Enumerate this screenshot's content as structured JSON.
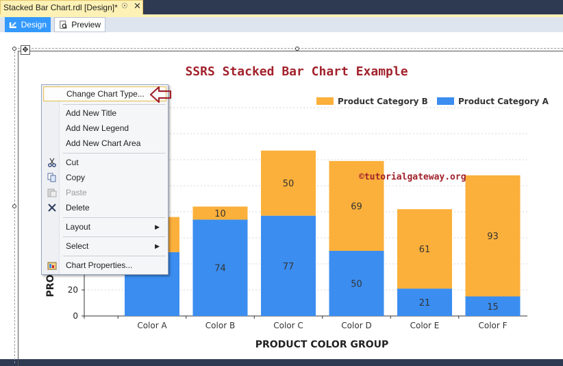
{
  "document_tab": {
    "title": "Stacked Bar Chart.rdl [Design]*",
    "pin_icon": "pin-icon",
    "close_icon": "close-icon"
  },
  "view_tabs": [
    {
      "label": "Design",
      "active": true,
      "icon": "design-icon"
    },
    {
      "label": "Preview",
      "active": false,
      "icon": "preview-icon"
    }
  ],
  "context_menu": {
    "items": [
      {
        "label": "Change Chart Type...",
        "state": "active"
      },
      {
        "label": "Add New Title"
      },
      {
        "label": "Add New Legend"
      },
      {
        "label": "Add New Chart Area"
      },
      {
        "label": "Cut",
        "icon": "scissors-icon"
      },
      {
        "label": "Copy",
        "icon": "copy-icon"
      },
      {
        "label": "Paste",
        "icon": "paste-icon",
        "state": "disabled"
      },
      {
        "label": "Delete",
        "icon": "delete-icon"
      },
      {
        "label": "Layout",
        "submenu": true
      },
      {
        "label": "Select",
        "submenu": true
      },
      {
        "label": "Chart Properties...",
        "icon": "properties-icon"
      }
    ]
  },
  "watermark": "©tutorialgateway.org",
  "colors": {
    "series_a": "#3b8df0",
    "series_b": "#fbb03b",
    "title": "#a1222c",
    "accent": "#3399ff"
  },
  "chart_data": {
    "type": "bar",
    "stacked": true,
    "title": "SSRS Stacked Bar Chart Example",
    "xlabel": "PRODUCT COLOR GROUP",
    "ylabel": "PRO",
    "categories": [
      "Color A",
      "Color B",
      "Color C",
      "Color D",
      "Color E",
      "Color F"
    ],
    "series": [
      {
        "name": "Product Category A",
        "values": [
          49,
          74,
          77,
          50,
          21,
          15
        ],
        "labels": [
          "",
          "74",
          "77",
          "50",
          "21",
          "15"
        ]
      },
      {
        "name": "Product Category B",
        "values": [
          27,
          10,
          50,
          69,
          61,
          93
        ],
        "labels": [
          "",
          "10",
          "50",
          "69",
          "61",
          "93"
        ]
      }
    ],
    "legend_order": [
      "Product Category B",
      "Product Category A"
    ],
    "legend_position": "top-right",
    "y_ticks": [
      "0",
      "20"
    ],
    "grid": true
  }
}
